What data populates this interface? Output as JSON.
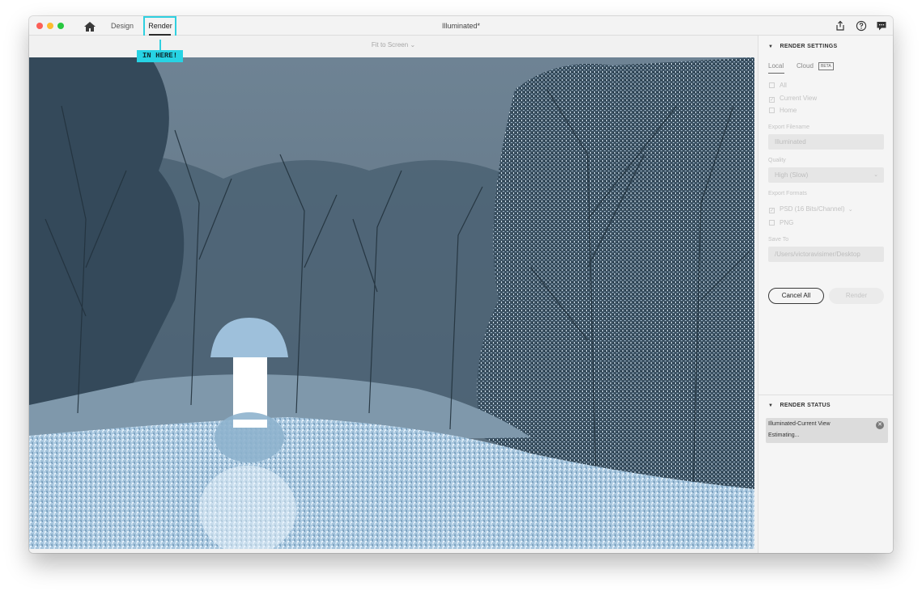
{
  "titlebar": {
    "tabs": [
      {
        "label": "Design"
      },
      {
        "label": "Render"
      }
    ],
    "window_title": "Illuminated*"
  },
  "callout": {
    "text": "IN HERE!"
  },
  "canvas": {
    "fit_label": "Fit to Screen",
    "fit_chevron": "⌄"
  },
  "render_settings": {
    "heading": "RENDER SETTINGS",
    "tabs": {
      "local": "Local",
      "cloud": "Cloud",
      "beta": "BETA"
    },
    "scope_options": [
      {
        "label": "All",
        "checked": false
      },
      {
        "label": "Current View",
        "checked": true
      },
      {
        "label": "Home",
        "checked": false
      }
    ],
    "export_filename_label": "Export Filename",
    "export_filename_value": "Illuminated",
    "quality_label": "Quality",
    "quality_value": "High (Slow)",
    "export_formats_label": "Export Formats",
    "formats": [
      {
        "label": "PSD (16 Bits/Channel)",
        "checked": true
      },
      {
        "label": "PNG",
        "checked": false
      }
    ],
    "save_to_label": "Save To",
    "save_to_value": "/Users/victoravisimer/Desktop",
    "cancel_all": "Cancel All",
    "render": "Render"
  },
  "render_status": {
    "heading": "RENDER STATUS",
    "job_name": "Illuminated-Current View",
    "job_status": "Estimating..."
  },
  "colors": {
    "accent_callout": "#27d3e4",
    "sky": "#5d7485",
    "snow_ground": "#a9c8e0"
  }
}
